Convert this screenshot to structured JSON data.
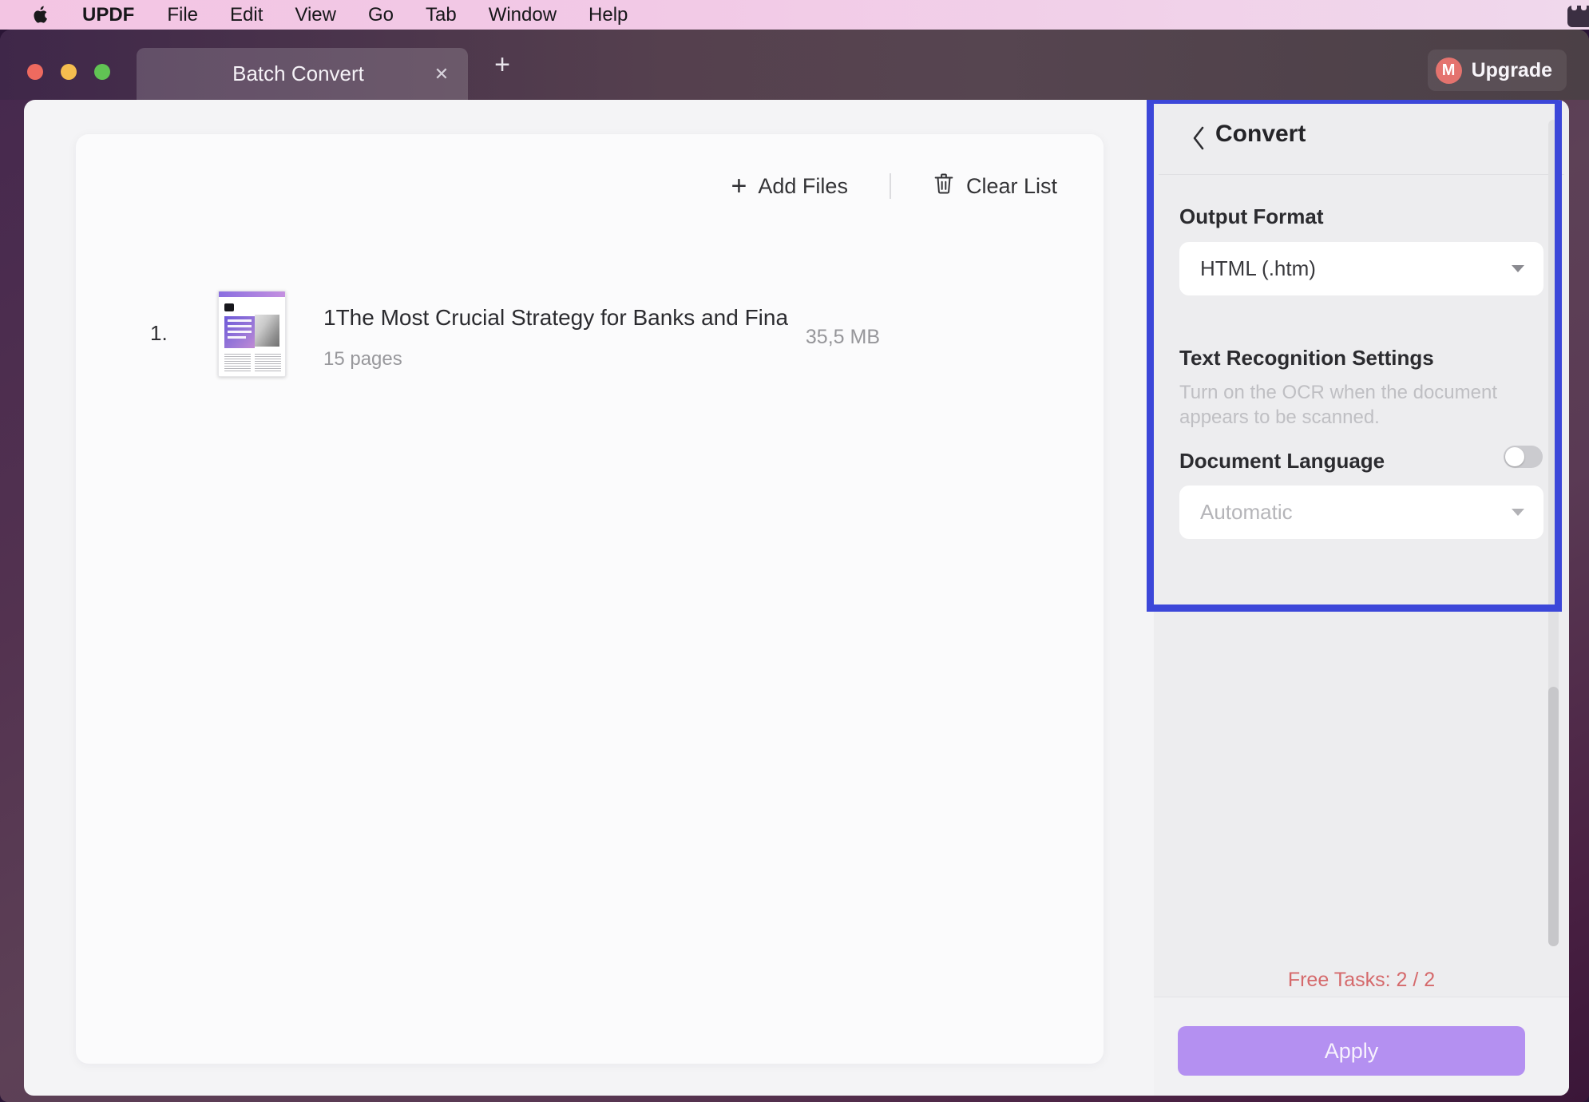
{
  "menu_bar": {
    "items": [
      "UPDF",
      "File",
      "Edit",
      "View",
      "Go",
      "Tab",
      "Window",
      "Help"
    ]
  },
  "titlebar": {
    "tab_title": "Batch Convert",
    "close_tab_glyph": "✕",
    "new_tab_glyph": "+",
    "avatar_initial": "M",
    "upgrade_label": "Upgrade"
  },
  "toolbar": {
    "add_files_glyph": "+",
    "add_files_label": "Add Files",
    "clear_list_label": "Clear List"
  },
  "file_list": [
    {
      "index": "1.",
      "title": "1The Most Crucial Strategy for Banks and Fina",
      "pages": "15 pages",
      "size": "35,5 MB"
    }
  ],
  "panel": {
    "title": "Convert",
    "output_format": {
      "label": "Output Format",
      "value": "HTML (.htm)"
    },
    "text_recognition": {
      "label": "Text Recognition Settings",
      "enabled": false,
      "description_line1": "Turn on the OCR when the document",
      "description_line2": "appears to be scanned."
    },
    "document_language": {
      "label": "Document Language",
      "value": "Automatic"
    },
    "free_tasks": "Free Tasks: 2 / 2",
    "apply_label": "Apply"
  },
  "colors": {
    "highlight_border": "#3c47d9",
    "apply_button": "#b490f1",
    "free_tasks_text": "#d5696b",
    "menubar_pink": "#f3c5e3",
    "avatar_red": "#e4736e",
    "traffic_red": "#ee6a5f",
    "traffic_yellow": "#f5bd4f",
    "traffic_green": "#61c354"
  }
}
